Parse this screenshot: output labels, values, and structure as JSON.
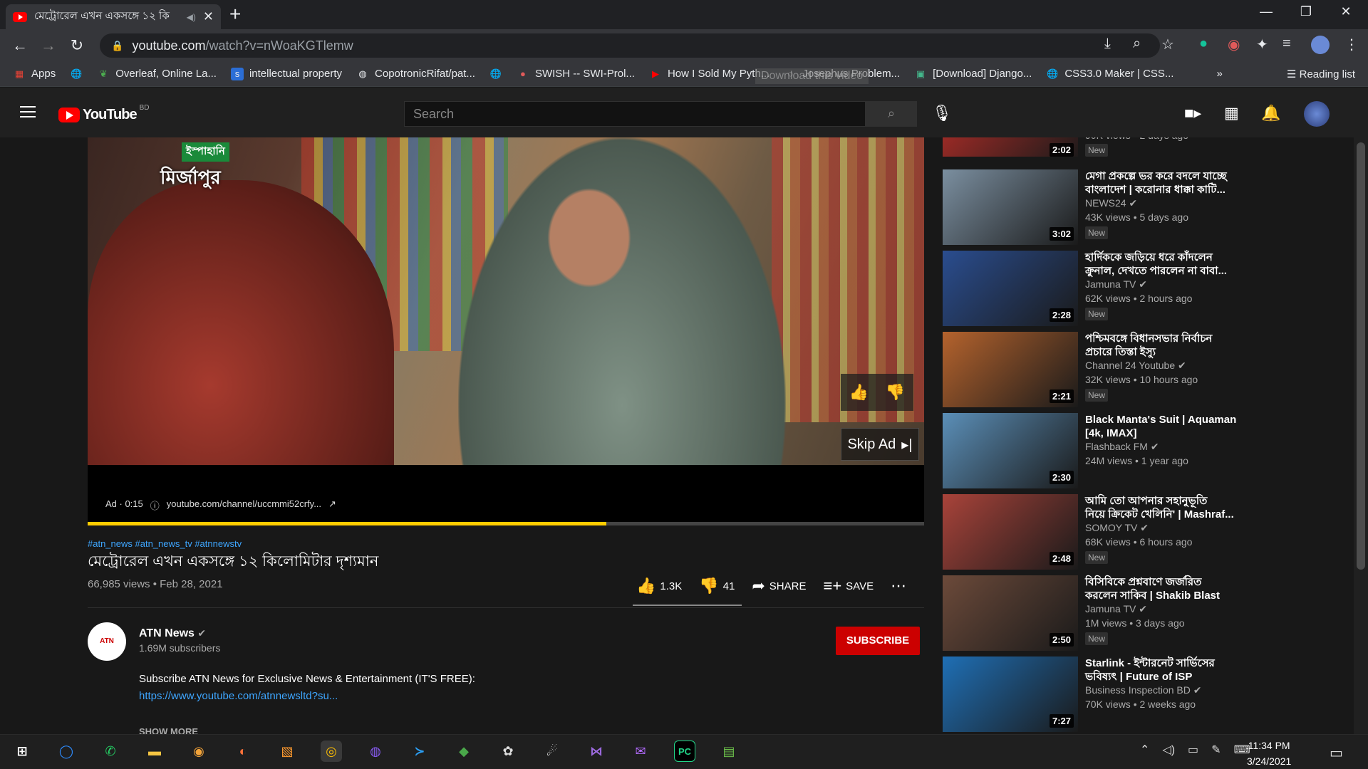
{
  "browser": {
    "tab_title": "মেট্রোরেল এখন একসঙ্গে ১২ কি",
    "url_host": "youtube.com",
    "url_path": "/watch?v=nWoaKGTlemw",
    "bookmarks": [
      "Apps",
      "Overleaf, Online La...",
      "intellectual property",
      "CopotronicRifat/pat...",
      "SWISH -- SWI-Prol...",
      "How I Sold My Pyth...",
      "Josephus Problem...",
      "[Download] Django...",
      "CSS3.0 Maker | CSS..."
    ],
    "download_overlay": "Download this video",
    "reading_list": "Reading list"
  },
  "youtube": {
    "logo_text": "YouTube",
    "country": "BD",
    "search_placeholder": "Search"
  },
  "player": {
    "brand_tag": "ইস্পাহানি",
    "brand_name": "মির্জাপুর",
    "skip_ad": "Skip Ad",
    "ad_label": "Ad · 0:15",
    "ad_url": "youtube.com/channel/uccmmi52crfy...",
    "ad_progress": 0.62
  },
  "video": {
    "hashtags": "#atn_news #atn_news_tv #atnnewstv",
    "title": "মেট্রোরেল এখন একসঙ্গে ১২ কিলোমিটার দৃশ্যমান",
    "stats": "66,985 views • Feb 28, 2021",
    "likes": "1.3K",
    "dislikes": "41",
    "share": "SHARE",
    "save": "SAVE"
  },
  "channel": {
    "name": "ATN News",
    "subs": "1.69M subscribers",
    "subscribe": "SUBSCRIBE",
    "desc1": "Subscribe ATN News for Exclusive News & Entertainment (IT'S FREE):",
    "desc2": "https://www.youtube.com/atnnewsltd?su...",
    "show_more": "SHOW MORE"
  },
  "related": [
    {
      "title1": "",
      "title2": "",
      "channel": "",
      "views": "90K views • 2 days ago",
      "dur": "2:02",
      "new": "New",
      "color": "#c8302a"
    },
    {
      "title1": "মেগা প্রকল্পে ভর করে বদলে যাচ্ছে",
      "title2": "বাংলাদেশ | করোনার ধাক্কা কাটি...",
      "channel": "NEWS24",
      "views": "43K views • 5 days ago",
      "dur": "3:02",
      "new": "New",
      "color": "#7b8fa0"
    },
    {
      "title1": "হার্দিককে জড়িয়ে ধরে কাঁদলেন",
      "title2": "ক্রুনাল, দেখতে পারলেন না বাবা...",
      "channel": "Jamuna TV",
      "views": "62K views • 2 hours ago",
      "dur": "2:28",
      "new": "New",
      "color": "#2a4d8f"
    },
    {
      "title1": "পশ্চিমবঙ্গে বিধানসভার নির্বাচন",
      "title2": "প্রচারে তিস্তা ইস্যু",
      "channel": "Channel 24 Youtube",
      "views": "32K views • 10 hours ago",
      "dur": "2:21",
      "new": "New",
      "color": "#b5632d"
    },
    {
      "title1": "Black Manta's Suit | Aquaman",
      "title2": "[4k, IMAX]",
      "channel": "Flashback FM",
      "views": "24M views • 1 year ago",
      "dur": "2:30",
      "new": "",
      "color": "#5b8fb8"
    },
    {
      "title1": "আমি তো আপনার সহানুভূতি",
      "title2": "নিয়ে ক্রিকেট খেলিনি' | Mashraf...",
      "channel": "SOMOY TV",
      "views": "68K views • 6 hours ago",
      "dur": "2:48",
      "new": "New",
      "color": "#a9433a"
    },
    {
      "title1": "বিসিবিকে প্রশ্নবাণে জর্জরিত",
      "title2": "করলেন সাকিব | Shakib Blast",
      "channel": "Jamuna TV",
      "views": "1M views • 3 days ago",
      "dur": "2:50",
      "new": "New",
      "color": "#6c4a3a"
    },
    {
      "title1": "Starlink - ইন্টারনেট সার্ভিসের",
      "title2": "ভবিষ্যৎ | Future of ISP",
      "channel": "Business Inspection BD",
      "views": "70K views • 2 weeks ago",
      "dur": "7:27",
      "new": "",
      "color": "#1f6fb5"
    }
  ],
  "taskbar": {
    "time": "11:34 PM",
    "date": "3/24/2021"
  }
}
